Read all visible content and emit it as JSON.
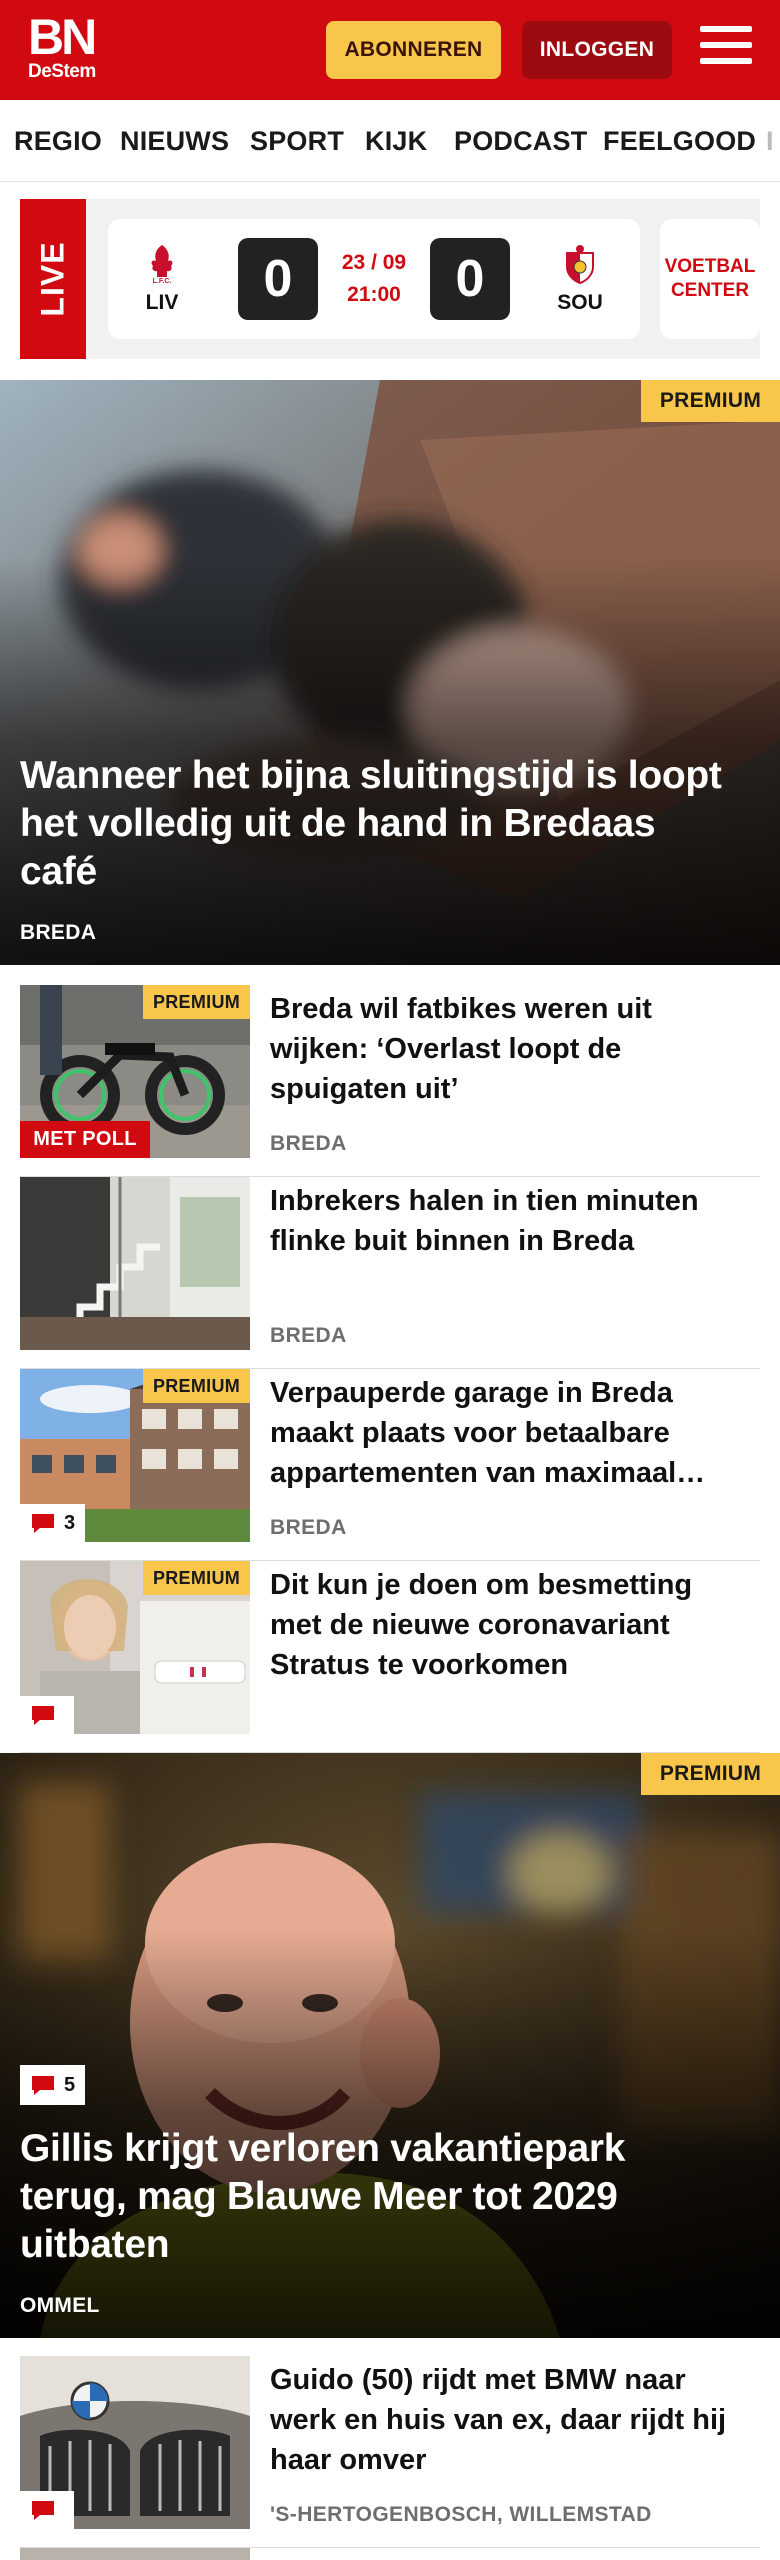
{
  "header": {
    "logo_main": "BN",
    "logo_sub": "DeStem",
    "subscribe_label": "ABONNEREN",
    "login_label": "INLOGGEN",
    "menu_icon": "hamburger-menu-icon",
    "brand_color": "#d10a11"
  },
  "nav": {
    "items": [
      "REGIO",
      "NIEUWS",
      "SPORT",
      "KIJK",
      "PODCAST",
      "FEELGOOD"
    ]
  },
  "live": {
    "label": "LIVE",
    "home_team": "LIV",
    "away_team": "SOU",
    "home_score": "0",
    "away_score": "0",
    "date": "23 / 09",
    "time": "21:00",
    "voetbal_center_label": "VOETBAL CENTER"
  },
  "articles": {
    "hero1": {
      "premium_label": "PREMIUM",
      "title": "Wanneer het bijna sluitingstijd is loopt het volledig uit de hand in Bredaas café",
      "location": "BREDA"
    },
    "list1": [
      {
        "premium_label": "PREMIUM",
        "badge": "MET POLL",
        "title": "Breda wil fatbikes weren uit wijken: ‘Overlast loopt de spuigaten uit’",
        "location": "BREDA"
      },
      {
        "title": "Inbrekers halen in tien minuten flinke buit binnen in Breda",
        "location": "BREDA"
      },
      {
        "premium_label": "PREMIUM",
        "comments": "3",
        "title": "Verpauperde garage in Breda maakt plaats voor betaalbare appartementen van maximaal…",
        "location": "BREDA"
      },
      {
        "premium_label": "PREMIUM",
        "comments": "",
        "title": "Dit kun je doen om besmetting met de nieuwe coronavariant Stratus te voorkomen",
        "location": ""
      }
    ],
    "hero2": {
      "premium_label": "PREMIUM",
      "comments": "5",
      "title": "Gillis krijgt verloren vakantiepark terug, mag Blauwe Meer tot 2029 uitbaten",
      "location": "OMMEL"
    },
    "list2": [
      {
        "comments": "",
        "title": "Guido (50) rijdt met BMW naar werk en huis van ex, daar rijdt hij haar omver",
        "location": "'S-HERTOGENBOSCH, WILLEMSTAD"
      }
    ]
  }
}
